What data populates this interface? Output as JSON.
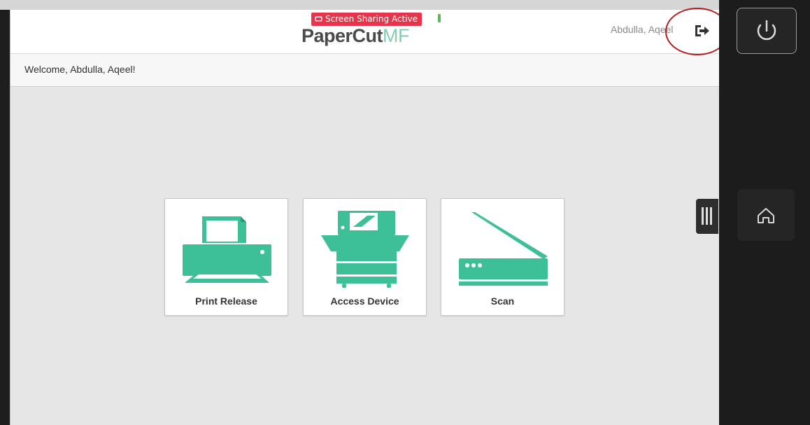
{
  "banner": {
    "text": "Screen Sharing Active"
  },
  "logo": {
    "part1": "PaperCut",
    "part2": "MF"
  },
  "header": {
    "user_name": "Abdulla, Aqeel"
  },
  "welcome": {
    "text": "Welcome, Abdulla, Aqeel!"
  },
  "tiles": [
    {
      "label": "Print Release",
      "icon": "printer-icon"
    },
    {
      "label": "Access Device",
      "icon": "copier-icon"
    },
    {
      "label": "Scan",
      "icon": "scanner-icon"
    }
  ],
  "colors": {
    "accent": "#3dbf98",
    "banner": "#e8344a",
    "annotation": "#b51e1e"
  },
  "side_panel": {
    "power_icon": "power-icon",
    "home_icon": "home-icon",
    "handle_icon": "menu-handle-icon"
  }
}
